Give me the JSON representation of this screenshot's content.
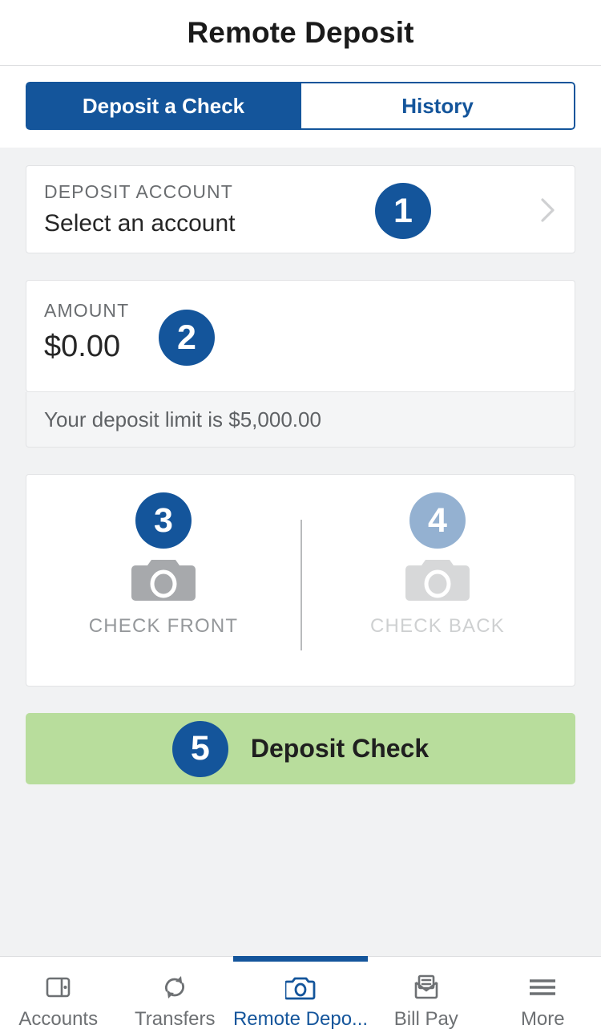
{
  "header": {
    "title": "Remote Deposit"
  },
  "tabs": [
    {
      "label": "Deposit a Check",
      "active": true,
      "name": "tab-deposit-a-check"
    },
    {
      "label": "History",
      "active": false,
      "name": "tab-history"
    }
  ],
  "colors": {
    "brand_blue": "#14559b",
    "deposit_button_green": "#b8dd9c",
    "page_background": "#f1f2f3",
    "muted_text": "#6a6d70"
  },
  "form": {
    "account": {
      "label": "DEPOSIT ACCOUNT",
      "value": "Select an account",
      "step": "1",
      "chevron_icon": "chevron-right-icon"
    },
    "amount": {
      "label": "AMOUNT",
      "value": "$0.00",
      "step": "2",
      "limit_text": "Your deposit limit is $5,000.00"
    },
    "capture": {
      "front": {
        "label": "CHECK FRONT",
        "step": "3",
        "icon": "camera-icon",
        "enabled": true
      },
      "back": {
        "label": "CHECK BACK",
        "step": "4",
        "icon": "camera-icon",
        "enabled": false
      }
    },
    "submit": {
      "label": "Deposit Check",
      "step": "5"
    }
  },
  "bottom_nav": [
    {
      "label": "Accounts",
      "icon": "wallet-icon",
      "active": false
    },
    {
      "label": "Transfers",
      "icon": "sync-icon",
      "active": false
    },
    {
      "label": "Remote Depo...",
      "icon": "camera-icon",
      "active": true
    },
    {
      "label": "Bill Pay",
      "icon": "envelope-icon",
      "active": false
    },
    {
      "label": "More",
      "icon": "hamburger-menu-icon",
      "active": false
    }
  ]
}
